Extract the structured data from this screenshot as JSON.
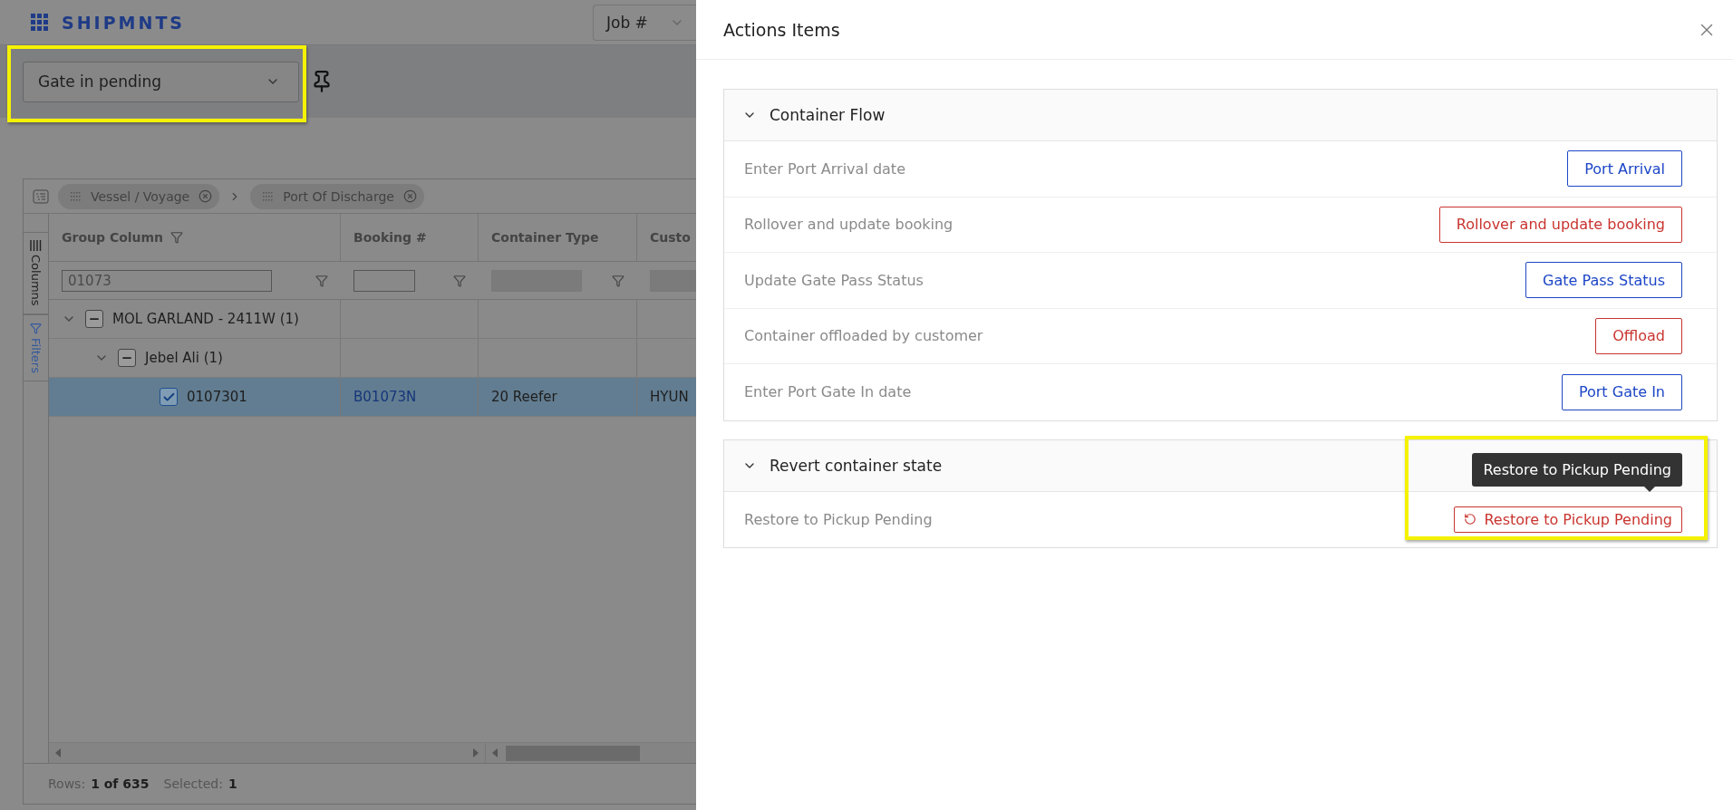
{
  "app": {
    "logo": "SHIPMNTS",
    "search_type": "Job #"
  },
  "toolbar": {
    "view_select": {
      "value": "Gate in pending",
      "highlighted": true
    }
  },
  "grid": {
    "group_chips": [
      {
        "label": "Vessel / Voyage"
      },
      {
        "label": "Port Of Discharge"
      }
    ],
    "side_tabs": [
      {
        "label": "Columns",
        "kind": "columns"
      },
      {
        "label": "Filters",
        "kind": "filters"
      }
    ],
    "columns": [
      {
        "title": "Group Column",
        "filter_value": "01073",
        "disabled": false
      },
      {
        "title": "Booking #",
        "disabled": false
      },
      {
        "title": "Container Type",
        "disabled": true
      },
      {
        "title": "Custo",
        "disabled": true
      }
    ],
    "rows": [
      {
        "label": "MOL GARLAND - 2411W",
        "count": "(1)",
        "expanded": true,
        "indeterminate": true,
        "children": [
          {
            "label": "Jebel Ali",
            "count": "(1)",
            "expanded": true,
            "indeterminate": true,
            "children": [
              {
                "label": "0107301",
                "checked": true,
                "selected": true,
                "cells": [
                  "B01073N",
                  "20 Reefer",
                  "HYUN"
                ]
              }
            ]
          }
        ]
      }
    ],
    "status": {
      "rows_label": "Rows:",
      "rows_value": "1 of 635",
      "selected_label": "Selected:",
      "selected_value": "1"
    }
  },
  "panel": {
    "title": "Actions Items",
    "sections": [
      {
        "title": "Container Flow",
        "expanded": true,
        "actions": [
          {
            "description": "Enter Port Arrival date",
            "button": "Port Arrival",
            "kind": "primary"
          },
          {
            "description": "Rollover and update booking",
            "button": "Rollover and update booking",
            "kind": "danger"
          },
          {
            "description": "Update Gate Pass Status",
            "button": "Gate Pass Status",
            "kind": "primary"
          },
          {
            "description": "Container offloaded by customer",
            "button": "Offload",
            "kind": "danger"
          },
          {
            "description": "Enter Port Gate In date",
            "button": "Port Gate In",
            "kind": "primary"
          }
        ]
      },
      {
        "title": "Revert container state",
        "expanded": true,
        "actions": [
          {
            "description": "Restore to Pickup Pending",
            "button": "Restore to Pickup Pending",
            "kind": "revert",
            "highlighted": true,
            "tooltip": "Restore to Pickup Pending"
          }
        ]
      }
    ]
  }
}
